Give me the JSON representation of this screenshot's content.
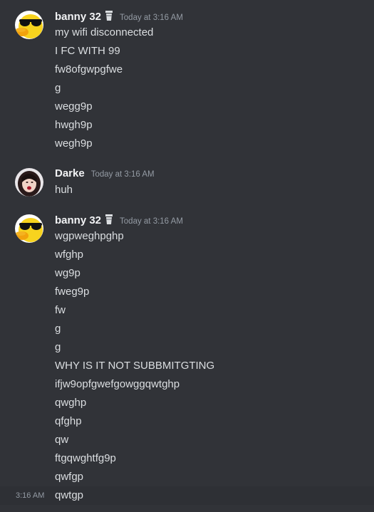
{
  "messages": [
    {
      "author": "banny 32",
      "timestamp": "Today at 3:16 AM",
      "avatar_icon": "yellow-duck-sunglasses",
      "badge_icon": "cup-icon",
      "lines": [
        "my wifi disconnected",
        "I FC WITH 99",
        "fw8ofgwpgfwe",
        "g",
        "wegg9p",
        "hwgh9p",
        "wegh9p"
      ]
    },
    {
      "author": "Darke",
      "timestamp": "Today at 3:16 AM",
      "avatar_icon": "girl-photo",
      "lines": [
        "huh"
      ]
    },
    {
      "author": "banny 32",
      "timestamp": "Today at 3:16 AM",
      "avatar_icon": "yellow-duck-sunglasses",
      "badge_icon": "cup-icon",
      "lines": [
        "wgpweghpghp",
        "wfghp",
        "wg9p",
        "fweg9p",
        "fw",
        "g",
        "g",
        "WHY IS IT NOT SUBBMITGTING",
        "ifjw9opfgwefgowggqwtghp",
        "qwghp",
        "qfghp",
        "qw",
        "ftgqwghtfg9p",
        "qwfgp",
        "qwtgp"
      ]
    }
  ],
  "hovered_time": "3:16 AM",
  "colors": {
    "background": "#313338",
    "hover_row": "#2e3035",
    "username": "#f2f3f5",
    "message_text": "#dbdee1",
    "timestamp": "#949ba4",
    "duck_yellow": "#f7d31e"
  }
}
